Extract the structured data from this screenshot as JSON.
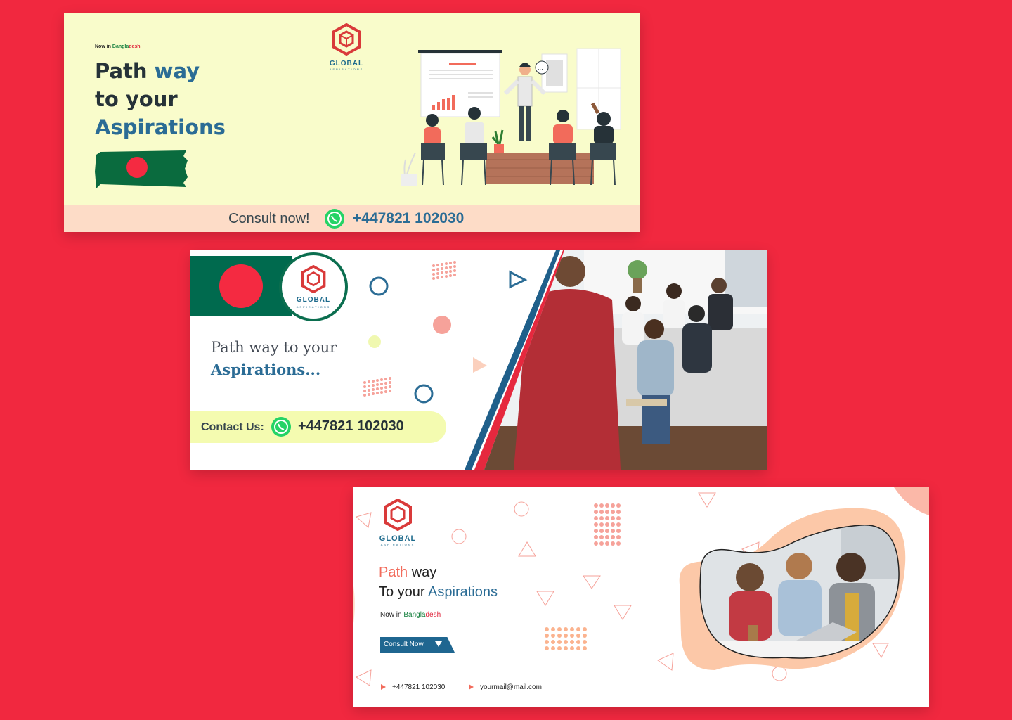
{
  "banner1": {
    "tag_prefix": "Now in",
    "tag_country_a": "Bangla",
    "tag_country_b": "desh",
    "head_line1_a": "Path",
    "head_line1_b": "way",
    "head_line2": "to your",
    "head_line3": "Aspirations",
    "logo_title": "GLOBAL",
    "logo_sub": "ASPIRATIONS",
    "cta_label": "Consult now!",
    "phone": "+447821 102030"
  },
  "banner2": {
    "logo_title": "GLOBAL",
    "logo_sub": "ASPIRATIONS",
    "head_line1": "Path way to your",
    "head_line2": "Aspirations...",
    "contact_label": "Contact Us:",
    "phone": "+447821 102030"
  },
  "banner3": {
    "logo_title": "GLOBAL",
    "logo_sub": "ASPIRATIONS",
    "head_line1_a": "Path",
    "head_line1_b": "way",
    "head_line2_a": "To your",
    "head_line2_b": "Aspirations",
    "tag_prefix": "Now in",
    "tag_country_a": "Bangla",
    "tag_country_b": "desh",
    "button_label": "Consult Now",
    "phone": "+447821 102030",
    "email": "yourmail@mail.com"
  },
  "colors": {
    "background": "#f1283f",
    "banner1_bg": "#f9fccb",
    "brand_blue": "#2b6c95",
    "accent_orange": "#f26b5b",
    "bangladesh_green": "#006a4e",
    "bangladesh_red": "#f42a41"
  },
  "icons": [
    "logo-mark-icon",
    "whatsapp-icon",
    "play-triangle-icon",
    "chevron-down-icon"
  ]
}
